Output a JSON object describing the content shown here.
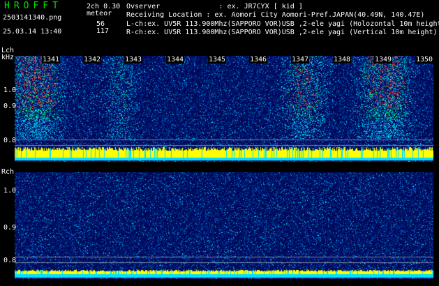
{
  "header": {
    "app_title": "HROFFT",
    "filename": "2503141340.png",
    "datetime": "25.03.14 13:40",
    "mode": "2ch 0.30",
    "meteor_label": "meteor",
    "lch_count": "56",
    "rch_count": "117"
  },
  "info": {
    "observer": "Ovserver              : ex. JR7CYX [ kid ]",
    "location": "Receiving Location : ex. Aomori City Aomori-Pref.JAPAN(40.49N, 140.47E)",
    "lch": "L-ch:ex. UV5R 113.900Mhz(SAPPORO VOR)USB ,2-ele yagi (Holozontal 10m height)",
    "rch": "R-ch:ex. UV5R 113.900Mhz(SAPPORO VOR)USB ,2-ele yagi (Vertical 10m height)"
  },
  "lch_panel": {
    "channel_label": "Lch",
    "unit_label": "kHz",
    "y_ticks": [
      "1.0",
      "0.9",
      "0.8"
    ],
    "time_ticks": [
      "1341",
      "1342",
      "1343",
      "1344",
      "1345",
      "1346",
      "1347",
      "1348",
      "1349",
      "1350"
    ]
  },
  "rch_panel": {
    "channel_label": "Rch",
    "y_ticks": [
      "1.0",
      "0.9",
      "0.8"
    ]
  },
  "colors": {
    "title_green": "#00e000",
    "signal_yellow": "#ffff00",
    "noise_cyan": "#00e0ff",
    "background_blue": "#000a5a"
  }
}
